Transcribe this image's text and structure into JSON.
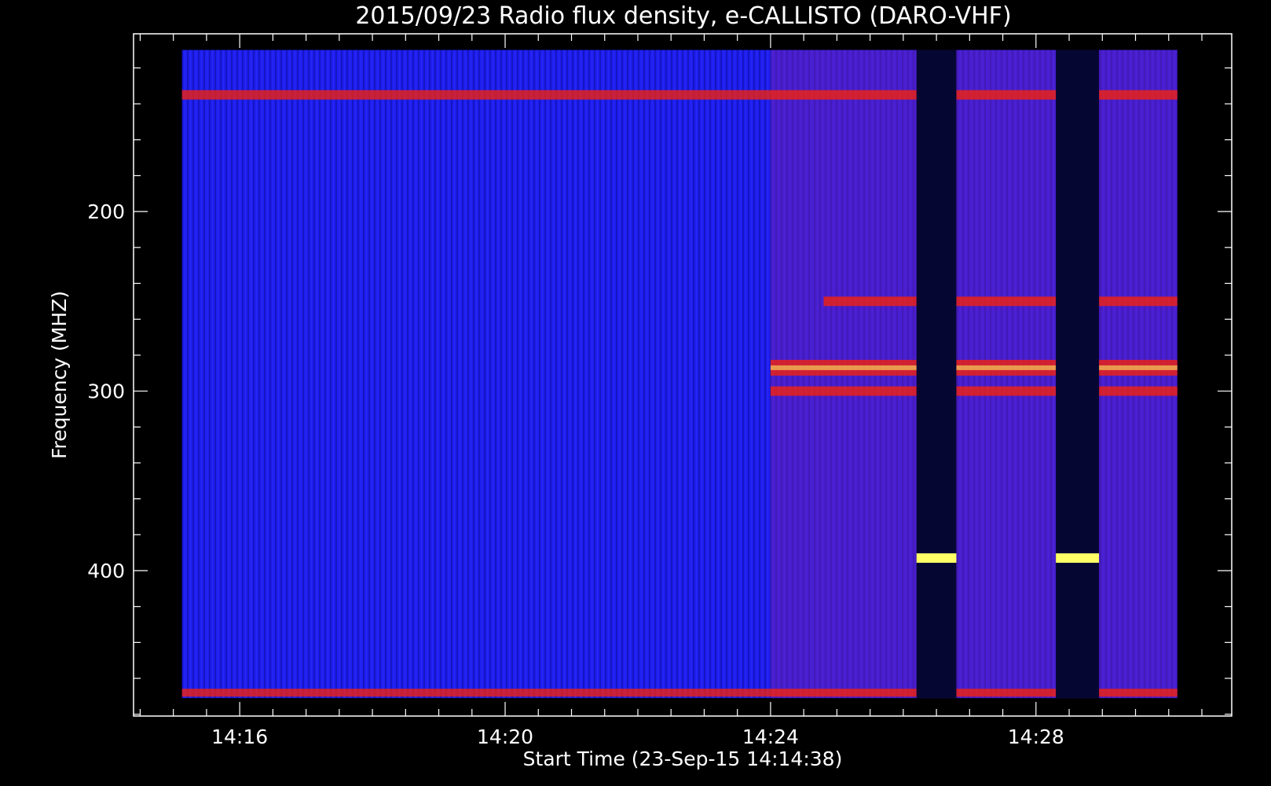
{
  "chart_data": {
    "type": "heatmap",
    "title": "2015/09/23  Radio flux density, e-CALLISTO (DARO-VHF)",
    "xlabel": "Start Time (23-Sep-15 14:14:38)",
    "ylabel": "Frequency (MHZ)",
    "x_ticks": [
      "14:16",
      "14:20",
      "14:24",
      "14:28"
    ],
    "x_tick_minutes": [
      16,
      20,
      24,
      28
    ],
    "x_axis_range_minutes": [
      14.4,
      30.95
    ],
    "data_time_range_minutes": [
      15.13,
      30.13
    ],
    "y_ticks": [
      200,
      300,
      400
    ],
    "y_axis_range_mhz": [
      101,
      481
    ],
    "y_axis_inverted": true,
    "data_freq_range_mhz": [
      110,
      471
    ],
    "colormap": [
      "#000000",
      "#1a1aff",
      "#ff2200",
      "#ffff66",
      "#ffffff"
    ],
    "background_color": "#1e1ef0",
    "gaps_minutes": [
      [
        26.2,
        26.8
      ],
      [
        28.3,
        28.95
      ]
    ],
    "events": [
      {
        "start_minute": 24.0,
        "end_minute": 30.13,
        "freq_mhz": 287,
        "intensity": "high"
      },
      {
        "start_minute": 24.0,
        "end_minute": 30.13,
        "freq_mhz": 300,
        "intensity": "medium"
      },
      {
        "start_minute": 24.8,
        "end_minute": 30.13,
        "freq_mhz": 250,
        "intensity": "medium"
      },
      {
        "start_minute": 15.13,
        "end_minute": 30.13,
        "freq_mhz": 135,
        "intensity": "medium"
      },
      {
        "start_minute": 15.13,
        "end_minute": 30.13,
        "freq_mhz": 468,
        "intensity": "low"
      }
    ]
  }
}
